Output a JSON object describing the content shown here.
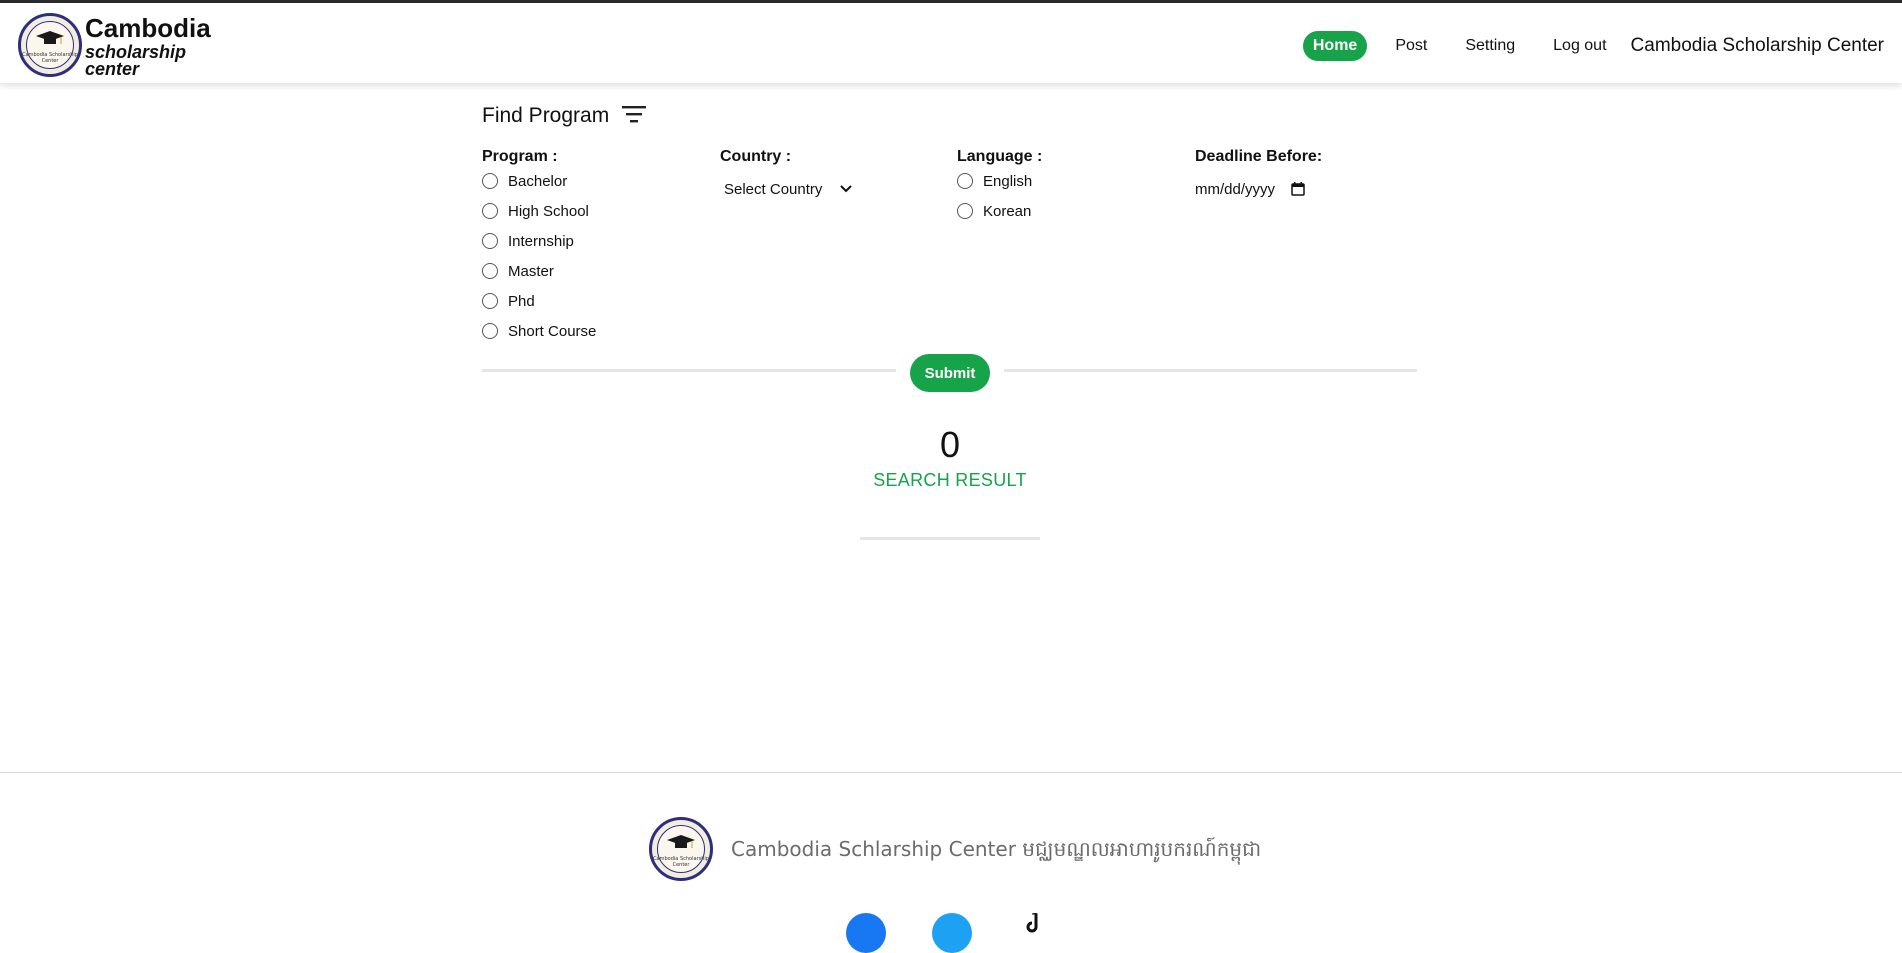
{
  "header": {
    "logo_line1": "Cambodia",
    "logo_line2": "scholarship",
    "logo_line3": "center",
    "seal_text": "Cambodia Scholarship Center",
    "nav": [
      {
        "label": "Home",
        "active": true
      },
      {
        "label": "Post",
        "active": false
      },
      {
        "label": "Setting",
        "active": false
      },
      {
        "label": "Log out",
        "active": false
      }
    ],
    "site_title": "Cambodia Scholarship Center"
  },
  "filters": {
    "title": "Find Program",
    "program": {
      "label": "Program :",
      "options": [
        "Bachelor",
        "High School",
        "Internship",
        "Master",
        "Phd",
        "Short Course"
      ]
    },
    "country": {
      "label": "Country :",
      "selected": "Select Country"
    },
    "language": {
      "label": "Language :",
      "options": [
        "English",
        "Korean"
      ]
    },
    "deadline": {
      "label": "Deadline Before:",
      "placeholder": "mm/dd/yyyy"
    },
    "submit_label": "Submit"
  },
  "results": {
    "count": "0",
    "label": "SEARCH RESULT"
  },
  "footer": {
    "text": "Cambodia Schlarship Center មជ្ឈមណ្ឌលអាហារូបករណ៍កម្ពុជា"
  },
  "colors": {
    "accent": "#17a34a",
    "seal_border": "#2d2f7d",
    "facebook": "#1877f2",
    "twitter": "#1da1f2"
  },
  "icons": {
    "filter": "filter-icon",
    "chevron": "chevron-down-icon",
    "calendar": "calendar-icon",
    "facebook": "facebook-icon",
    "twitter": "twitter-icon",
    "tiktok": "tiktok-icon"
  }
}
